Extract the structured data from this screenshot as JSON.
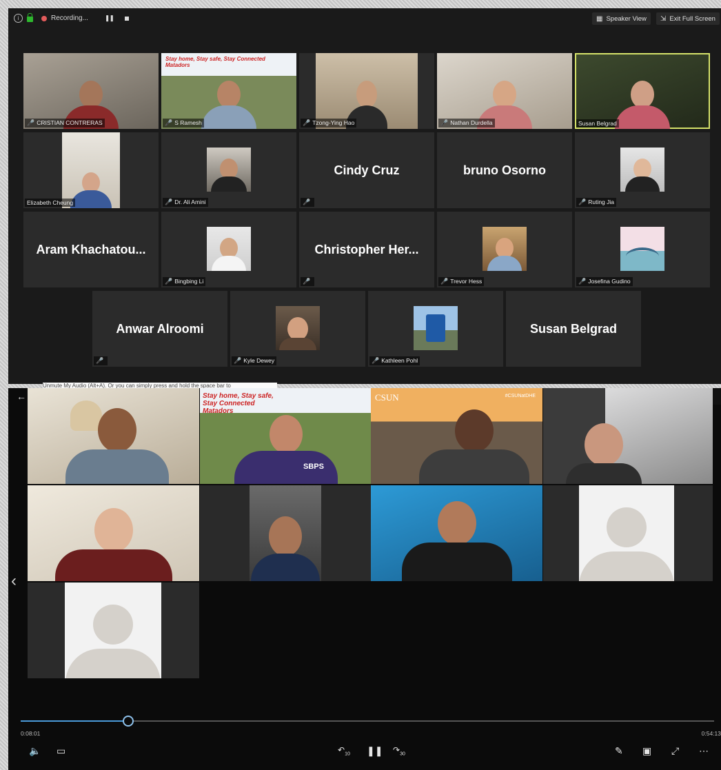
{
  "zoom": {
    "recording_label": "Recording...",
    "speaker_view_label": "Speaker View",
    "exit_fullscreen_label": "Exit Full Screen",
    "accent_active": "#d6e36a",
    "mic_muted_color": "#e04545",
    "tiles": [
      {
        "name": "CRISTIAN CONTRERAS",
        "muted": true,
        "kind": "video"
      },
      {
        "name": "S Ramesh",
        "muted": true,
        "kind": "video",
        "banner": "Stay home, Stay safe, Stay Connected Matadors"
      },
      {
        "name": "Tzong-Ying Hao",
        "muted": true,
        "kind": "video"
      },
      {
        "name": "Nathan Durdella",
        "muted": true,
        "kind": "video"
      },
      {
        "name": "Susan Belgrad",
        "muted": false,
        "kind": "video",
        "active": true
      },
      {
        "name": "Elizabeth Cheung",
        "muted": false,
        "kind": "photo"
      },
      {
        "name": "Dr. Ali Amini",
        "muted": true,
        "kind": "photo"
      },
      {
        "display": "Cindy Cruz",
        "muted": true,
        "kind": "name"
      },
      {
        "display": "bruno Osorno",
        "muted": false,
        "kind": "name"
      },
      {
        "name": "Ruting Jia",
        "muted": true,
        "kind": "photo"
      },
      {
        "display": "Aram  Khachatou...",
        "muted": false,
        "kind": "name"
      },
      {
        "name": "Bingbing Li",
        "muted": true,
        "kind": "photo"
      },
      {
        "display": "Christopher  Her...",
        "muted": true,
        "kind": "name"
      },
      {
        "name": "Trevor Hess",
        "muted": true,
        "kind": "photo"
      },
      {
        "name": "Josefina Gudino",
        "muted": true,
        "kind": "photo"
      },
      {
        "display": "Anwar Alroomi",
        "muted": true,
        "kind": "name"
      },
      {
        "name": "Kyle Dewey",
        "muted": true,
        "kind": "photo"
      },
      {
        "name": "Kathleen Pohl",
        "muted": true,
        "kind": "photo"
      },
      {
        "display": "Susan Belgrad",
        "muted": false,
        "kind": "name"
      }
    ]
  },
  "tooltip_text": "Unmute My Audio (Alt+A). Or you can simply press and hold the space bar to",
  "player": {
    "overlay_text": {
      "csun": "CSUN",
      "hashtag": "#CSUNatDHE",
      "sbps": "SBPS"
    },
    "banner_text": "Stay home, Stay safe, Stay Connected Matadors",
    "elapsed": "0:08:01",
    "total": "0:54:13",
    "progress_fraction": 0.155,
    "seek_color": "#4a9ad9",
    "skip_back_label": "10",
    "skip_forward_label": "30"
  },
  "icons": {
    "info": "info-icon",
    "lock": "lock-icon",
    "pause": "pause-icon",
    "stop": "stop-icon",
    "volume": "volume-icon",
    "captions": "captions-icon",
    "play_pause": "pause-icon",
    "pen": "pen-icon",
    "mini": "miniview-icon",
    "fullscreen": "fullscreen-icon",
    "more": "more-icon"
  }
}
